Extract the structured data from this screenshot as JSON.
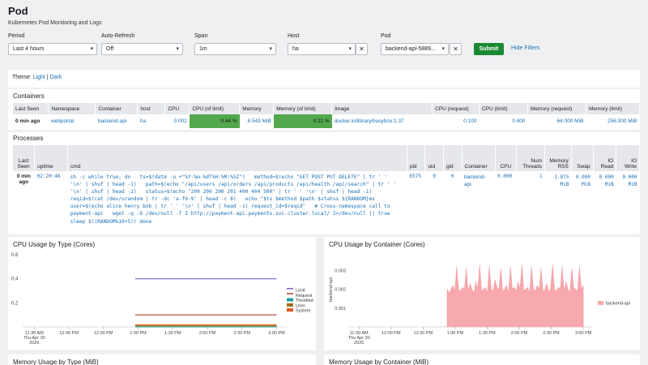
{
  "page": {
    "title": "Pod",
    "subtitle": "Kubernetes Pod Monitoring and Logs"
  },
  "filters": {
    "period": {
      "label": "Period",
      "value": "Last 4 hours"
    },
    "refresh": {
      "label": "Auto-Refresh",
      "value": "Off"
    },
    "span": {
      "label": "Span",
      "value": "1m"
    },
    "host": {
      "label": "Host",
      "value": "ha"
    },
    "pod": {
      "label": "Pod",
      "value": "backend-api-5889..."
    },
    "submit": "Submit",
    "hide": "Hide Filters"
  },
  "theme": {
    "label": "Theme:",
    "light": "Light",
    "sep": "|",
    "dark": "Dark"
  },
  "containers": {
    "title": "Containers",
    "headers": [
      "Last Seen",
      "Namespace",
      "Container",
      "host",
      "CPU",
      "CPU (of limit)",
      "Memory",
      "Memory (of limit)",
      "Image",
      "CPU (request)",
      "CPU (limit)",
      "Memory (request)",
      "Memory (limit)"
    ],
    "row": {
      "last_seen": "0 min ago",
      "namespace": "webportal",
      "container": "backend-api",
      "host": "ha",
      "cpu": "0.002",
      "cpu_of_limit": "0.44 %",
      "memory": "8.543 MiB",
      "memory_of_limit": "0.21 %",
      "image": "docker.io/library/busybox:1.37",
      "cpu_request": "0.100",
      "cpu_limit": "0.400",
      "memory_request": "64.000 MiB",
      "memory_limit": "256.000 MiB"
    }
  },
  "processes": {
    "title": "Processes",
    "headers": {
      "last_seen": "Last Seen",
      "uptime": "uptime",
      "cmd": "cmd",
      "pid": "pid",
      "uid": "uid",
      "gid": "gid",
      "container": "Container",
      "cpu": "CPU",
      "num_threads": "Num Threads",
      "memory_rss": "Memory RSS",
      "swap": "Swap",
      "io_read": "IO Read",
      "io_write": "IO Write"
    },
    "row": {
      "last_seen": "0 min ago",
      "uptime": "02:20:46",
      "cmd_lines": [
        "sh -c while true; do   ts=$(date -u +\"%Y-%m-%dT%H:%M:%SZ\")   method=$(echo \"GET POST PUT DELETE\" | tr ' '",
        "'\\n' | shuf | head -1)   path=$(echo \"/api/users /api/orders /api/products /api/health /api/search\" | tr ' '",
        "'\\n' | shuf | head -1)   status=$(echo \"200 200 200 201 400 404 500\" | tr ' ' '\\n' | shuf | head -1)",
        "reqid=$(cat /dev/urandom | tr -dc 'a-f0-9' | head -c 8)   echo \"$ts $method $path $status ${RANDOM}ms",
        "user=$(echo alice henry bob | tr ' ' '\\n' | shuf | head -1) request_id=$reqid\"   # Cross-namespace call to",
        "payment-api   wget -q -O /dev/null -T 2 http://payment-api.payments.svc.cluster.local/ 2>/dev/null || true",
        "sleep $((RANDOM%10+5)) done"
      ],
      "pid": "6575",
      "uid": "0",
      "gid": "0",
      "container": "backend-api",
      "cpu": "0.000",
      "num_threads": "1",
      "memory_rss": "1.875 MiB",
      "swap": "0.000 MiB",
      "io_read": "0.000 MiB",
      "io_write": "0.000 MiB"
    }
  },
  "charts": {
    "cpu_type_title": "CPU Usage by Type (Cores)",
    "cpu_container_title": "CPU Usage by Container (Cores)",
    "memory_type_title": "Memory Usage by Type (MiB)",
    "memory_container_title": "Memory Usage by Container (MiB)"
  },
  "chart_data": [
    {
      "type": "line",
      "title": "CPU Usage by Type (Cores)",
      "x_ticks": [
        "11:30 AM Thu Apr 30 2026",
        "12:00 PM",
        "12:30 PM",
        "1:00 PM",
        "1:30 PM",
        "2:00 PM",
        "2:30 PM",
        "3:00 PM"
      ],
      "ylim": [
        0,
        0.6
      ],
      "y_ticks": [
        "0.6",
        "0.4",
        "0.2"
      ],
      "x_range_hours": [
        11.333,
        15.1
      ],
      "series": [
        {
          "name": "Limit",
          "color": "#7b5fd1",
          "x_start": 12.958,
          "x_end": 15.0,
          "value": 0.4
        },
        {
          "name": "Request",
          "color": "#b23a30",
          "x_start": 12.958,
          "x_end": 15.0,
          "value": 0.1
        },
        {
          "name": "Throttled",
          "color": "#1a9c96",
          "x_start": 12.958,
          "x_end": 15.0,
          "value": 0.0
        },
        {
          "name": "User",
          "color": "#9e6b12",
          "x_start": 12.958,
          "x_end": 15.0,
          "value": 0.0
        },
        {
          "name": "System",
          "color": "#e0571a",
          "x_start": 12.958,
          "x_end": 15.0,
          "value": 0.0
        }
      ],
      "legend": "right"
    },
    {
      "type": "area",
      "title": "CPU Usage by Container (Cores)",
      "ylabel": "backend-api",
      "ylim": [
        0,
        0.004
      ],
      "y_ticks": [
        "0.003",
        "0.002",
        "0.001"
      ],
      "x_ticks": [
        "11:30 AM Thu Apr 30 2026",
        "12:00 PM",
        "12:30 PM",
        "1:00 PM",
        "1:30 PM",
        "2:00 PM",
        "2:30 PM",
        "3:00 PM"
      ],
      "series": [
        {
          "name": "backend-api",
          "color": "#f7a9ad",
          "x_start": 12.875,
          "x_end": 15.0,
          "values": [
            0.002,
            0.0018,
            0.002,
            0.0022,
            0.0019,
            0.0032,
            0.002,
            0.0019,
            0.0021,
            0.002,
            0.0031,
            0.0019,
            0.0023,
            0.002,
            0.0018,
            0.0024,
            0.002,
            0.0033,
            0.0019,
            0.002,
            0.0021,
            0.0018,
            0.0032,
            0.002,
            0.0019,
            0.0025,
            0.0021,
            0.002,
            0.0031,
            0.0019,
            0.002,
            0.0022,
            0.0018,
            0.0032,
            0.002,
            0.0021,
            0.0019,
            0.0024,
            0.002,
            0.0033,
            0.0019,
            0.002,
            0.0021,
            0.0018,
            0.0032,
            0.002,
            0.0019,
            0.0022,
            0.002,
            0.0031,
            0.0019,
            0.002,
            0.0023,
            0.0018,
            0.0021,
            0.0033,
            0.002,
            0.0019,
            0.0021,
            0.002,
            0.0032,
            0.0019,
            0.0024,
            0.002,
            0.0018,
            0.0031,
            0.0021,
            0.002,
            0.0019,
            0.0032,
            0.002,
            0.0022
          ]
        }
      ],
      "legend": "right"
    }
  ]
}
